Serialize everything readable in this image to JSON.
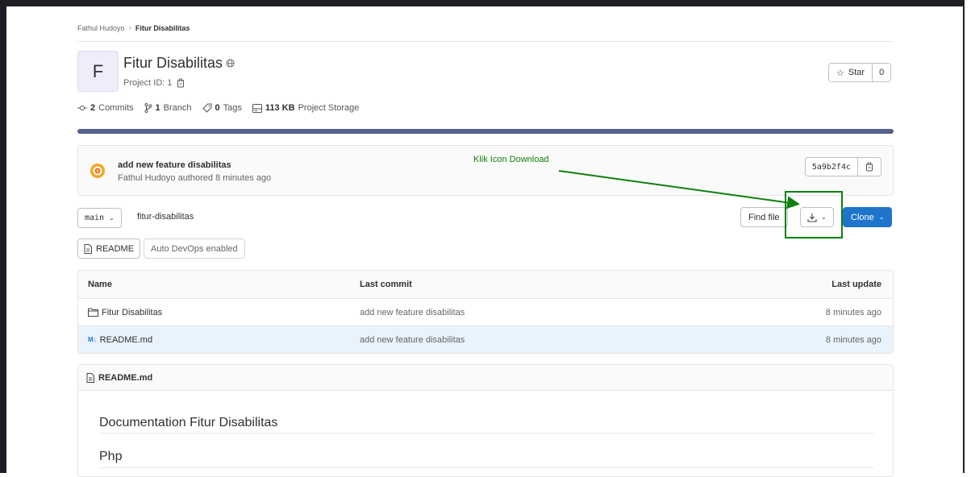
{
  "breadcrumb": {
    "parent": "Fathul Hudoyo",
    "current": "Fitur Disabilitas"
  },
  "project": {
    "avatar_letter": "F",
    "title": "Fitur Disabilitas",
    "id_text": "Project ID: 1",
    "star_label": "Star",
    "star_count": "0"
  },
  "stats": {
    "commits_count": "2",
    "commits_label": "Commits",
    "branch_count": "1",
    "branch_label": "Branch",
    "tags_count": "0",
    "tags_label": "Tags",
    "storage_value": "113 KB",
    "storage_label": "Project Storage"
  },
  "storage_bar": {
    "fill_fraction": 1.0,
    "color": "#54628c"
  },
  "commit": {
    "title": "add new feature disabilitas",
    "author_meta": "Fathul Hudoyo authored 8 minutes ago",
    "sha": "5a9b2f4c"
  },
  "annotation": {
    "text": "Klik Icon Download",
    "color": "#108010"
  },
  "repo_bar": {
    "branch": "main",
    "path": "fitur-disabilitas",
    "find_file_label": "Find file",
    "clone_label": "Clone"
  },
  "badges": {
    "readme_label": "README",
    "devops_label": "Auto DevOps enabled"
  },
  "table": {
    "headers": {
      "name": "Name",
      "last_commit": "Last commit",
      "last_update": "Last update"
    },
    "rows": [
      {
        "icon": "folder-icon",
        "name": "Fitur Disabilitas",
        "last_commit": "add new feature disabilitas",
        "last_update": "8 minutes ago"
      },
      {
        "icon": "markdown-icon",
        "name": "README.md",
        "last_commit": "add new feature disabilitas",
        "last_update": "8 minutes ago"
      }
    ]
  },
  "readme": {
    "filename": "README.md",
    "heading1": "Documentation Fitur Disabilitas",
    "heading2": "Php"
  },
  "colors": {
    "primary": "#1f75cb",
    "highlight_row": "#e9f3fc"
  }
}
